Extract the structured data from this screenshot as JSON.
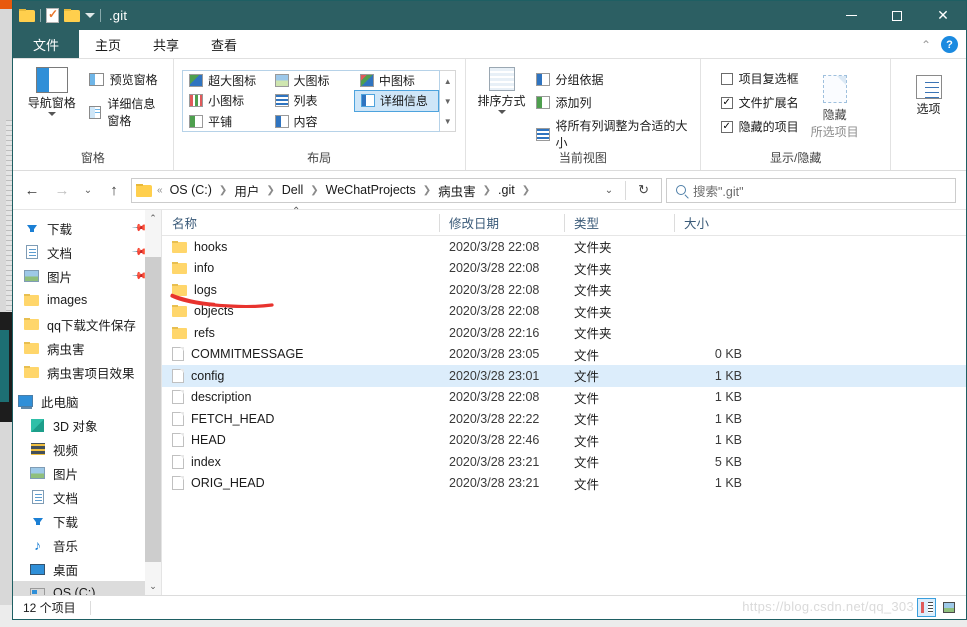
{
  "window": {
    "title": ".git",
    "quick_access": [
      "folder-icon",
      "properties-icon",
      "new-folder-icon",
      "customize-caret-icon"
    ],
    "controls": {
      "minimize": "minimize-icon",
      "maximize": "maximize-icon",
      "close": "✕"
    }
  },
  "tabs": [
    {
      "label": "文件",
      "active": true
    },
    {
      "label": "主页",
      "active": false
    },
    {
      "label": "共享",
      "active": false
    },
    {
      "label": "查看",
      "active": false
    }
  ],
  "tabrow_right": {
    "collapse": "⌃",
    "help": "?"
  },
  "ribbon": {
    "groups": [
      {
        "label": "窗格",
        "big_button": {
          "label": "导航窗格",
          "icon": "nav-pane-icon"
        },
        "items": [
          {
            "label": "预览窗格",
            "icon": "preview-pane-icon"
          },
          {
            "label": "详细信息窗格",
            "icon": "details-pane-icon"
          }
        ]
      },
      {
        "label": "布局",
        "gallery": [
          {
            "label": "超大图标",
            "selected": false
          },
          {
            "label": "大图标",
            "selected": false
          },
          {
            "label": "中图标",
            "selected": false
          },
          {
            "label": "小图标",
            "selected": false
          },
          {
            "label": "列表",
            "selected": false
          },
          {
            "label": "详细信息",
            "selected": true
          },
          {
            "label": "平铺",
            "selected": false
          },
          {
            "label": "内容",
            "selected": false
          }
        ]
      },
      {
        "label": "当前视图",
        "big_button": {
          "label": "排序方式",
          "icon": "sort-icon"
        },
        "items": [
          {
            "label": "分组依据",
            "icon": "group-by-icon",
            "caret": true
          },
          {
            "label": "添加列",
            "icon": "add-column-icon",
            "caret": true
          },
          {
            "label": "将所有列调整为合适的大小",
            "icon": "fit-columns-icon",
            "caret": false
          }
        ]
      },
      {
        "label": "显示/隐藏",
        "checkboxes": [
          {
            "label": "项目复选框",
            "checked": false
          },
          {
            "label": "文件扩展名",
            "checked": true
          },
          {
            "label": "隐藏的项目",
            "checked": true
          }
        ],
        "hide_button": {
          "label": "隐藏",
          "sub": "所选项目"
        },
        "options_button": {
          "label": "选项"
        }
      }
    ]
  },
  "address": {
    "back": "←",
    "forward": "→",
    "history_caret": "⌄",
    "up": "↑",
    "root_icon": "folder-icon",
    "overflow": "«",
    "crumbs": [
      "OS (C:)",
      "用户",
      "Dell",
      "WeChatProjects",
      "病虫害",
      ".git"
    ],
    "dropdown_caret": "⌄",
    "refresh": "↻",
    "search_placeholder": "搜索\".git\""
  },
  "sidebar": {
    "items": [
      {
        "label": "下载",
        "icon": "download-icon",
        "pinned": true,
        "indent": 1,
        "selected": false
      },
      {
        "label": "文档",
        "icon": "documents-icon",
        "pinned": true,
        "indent": 1,
        "selected": false
      },
      {
        "label": "图片",
        "icon": "pictures-icon",
        "pinned": true,
        "indent": 1,
        "selected": false
      },
      {
        "label": "images",
        "icon": "folder-icon",
        "pinned": false,
        "indent": 1,
        "selected": false
      },
      {
        "label": "qq下载文件保存",
        "icon": "folder-icon",
        "pinned": false,
        "indent": 1,
        "selected": false
      },
      {
        "label": "病虫害",
        "icon": "folder-icon",
        "pinned": false,
        "indent": 1,
        "selected": false
      },
      {
        "label": "病虫害项目效果",
        "icon": "folder-icon",
        "pinned": false,
        "indent": 1,
        "selected": false
      },
      {
        "label": "此电脑",
        "icon": "this-pc-icon",
        "pinned": false,
        "indent": 0,
        "selected": false
      },
      {
        "label": "3D 对象",
        "icon": "3d-objects-icon",
        "pinned": false,
        "indent": 1,
        "selected": false
      },
      {
        "label": "视频",
        "icon": "videos-icon",
        "pinned": false,
        "indent": 1,
        "selected": false
      },
      {
        "label": "图片",
        "icon": "pictures-icon",
        "pinned": false,
        "indent": 1,
        "selected": false
      },
      {
        "label": "文档",
        "icon": "documents-icon",
        "pinned": false,
        "indent": 1,
        "selected": false
      },
      {
        "label": "下载",
        "icon": "download-icon",
        "pinned": false,
        "indent": 1,
        "selected": false
      },
      {
        "label": "音乐",
        "icon": "music-icon",
        "pinned": false,
        "indent": 1,
        "selected": false
      },
      {
        "label": "桌面",
        "icon": "desktop-icon",
        "pinned": false,
        "indent": 1,
        "selected": false
      },
      {
        "label": "OS (C:)",
        "icon": "drive-icon",
        "pinned": false,
        "indent": 1,
        "selected": true
      }
    ],
    "scroll_up": "⌃",
    "scroll_down": "⌄"
  },
  "filelist": {
    "columns": [
      "名称",
      "修改日期",
      "类型",
      "大小"
    ],
    "sort_indicator": "⌃",
    "rows": [
      {
        "name": "hooks",
        "date": "2020/3/28 22:08",
        "type": "文件夹",
        "size": "",
        "kind": "folder",
        "selected": false
      },
      {
        "name": "info",
        "date": "2020/3/28 22:08",
        "type": "文件夹",
        "size": "",
        "kind": "folder",
        "selected": false
      },
      {
        "name": "logs",
        "date": "2020/3/28 22:08",
        "type": "文件夹",
        "size": "",
        "kind": "folder",
        "selected": false
      },
      {
        "name": "objects",
        "date": "2020/3/28 22:08",
        "type": "文件夹",
        "size": "",
        "kind": "folder",
        "selected": false
      },
      {
        "name": "refs",
        "date": "2020/3/28 22:16",
        "type": "文件夹",
        "size": "",
        "kind": "folder",
        "selected": false
      },
      {
        "name": "COMMITMESSAGE",
        "date": "2020/3/28 23:05",
        "type": "文件",
        "size": "0 KB",
        "kind": "file",
        "selected": false
      },
      {
        "name": "config",
        "date": "2020/3/28 23:01",
        "type": "文件",
        "size": "1 KB",
        "kind": "file",
        "selected": true
      },
      {
        "name": "description",
        "date": "2020/3/28 22:08",
        "type": "文件",
        "size": "1 KB",
        "kind": "file",
        "selected": false
      },
      {
        "name": "FETCH_HEAD",
        "date": "2020/3/28 22:22",
        "type": "文件",
        "size": "1 KB",
        "kind": "file",
        "selected": false
      },
      {
        "name": "HEAD",
        "date": "2020/3/28 22:46",
        "type": "文件",
        "size": "1 KB",
        "kind": "file",
        "selected": false
      },
      {
        "name": "index",
        "date": "2020/3/28 23:21",
        "type": "文件",
        "size": "5 KB",
        "kind": "file",
        "selected": false
      },
      {
        "name": "ORIG_HEAD",
        "date": "2020/3/28 23:21",
        "type": "文件",
        "size": "1 KB",
        "kind": "file",
        "selected": false
      }
    ]
  },
  "annotation": {
    "color": "#e8332e",
    "target": "logs"
  },
  "statusbar": {
    "item_count": "12 个项目",
    "watermark": "https://blog.csdn.net/qq_303",
    "view_buttons": [
      {
        "name": "details-view",
        "active": true
      },
      {
        "name": "large-icons-view",
        "active": false
      }
    ]
  },
  "colors": {
    "accent": "#2c5f63",
    "selection": "#dcedfb",
    "annotation": "#e8332e"
  }
}
